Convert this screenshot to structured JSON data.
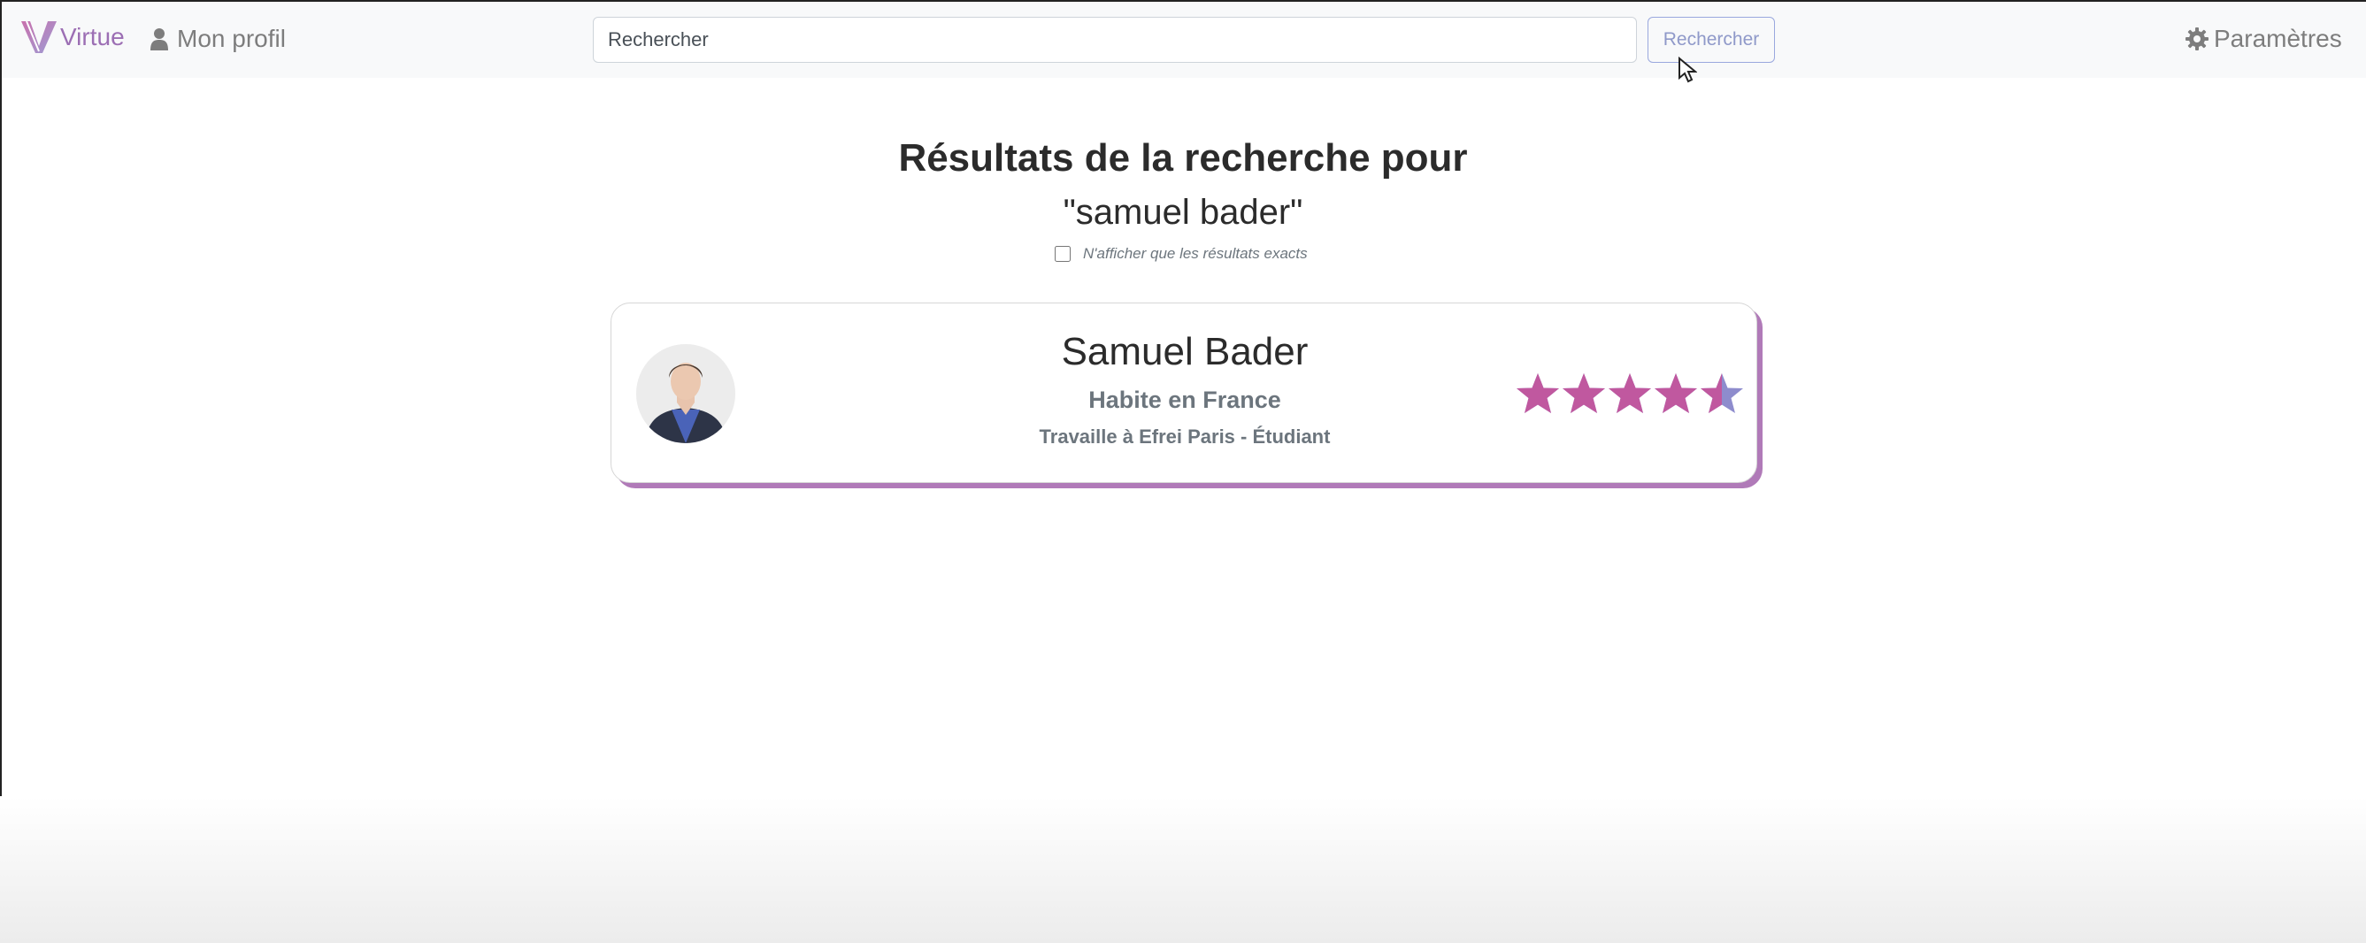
{
  "navbar": {
    "brand": "Virtue",
    "brand_icon": "virtue-logo-icon",
    "profile_label": "Mon profil",
    "profile_icon": "user-icon",
    "search_placeholder": "Rechercher",
    "search_button": "Rechercher",
    "settings_label": "Paramètres",
    "settings_icon": "gear-icon"
  },
  "results": {
    "title": "Résultats de la recherche pour",
    "query": "\"samuel bader\"",
    "exact_label": "N'afficher que les résultats exacts",
    "exact_checked": false
  },
  "cards": [
    {
      "name": "Samuel Bader",
      "home": "Habite en France",
      "work": "Travaille à Efrei Paris - Étudiant",
      "rating": 4.5,
      "rating_max": 5
    }
  ],
  "colors": {
    "accent": "#c0589f",
    "accent_secondary": "#8e8ccd",
    "brand": "#9c6fb4",
    "card_shadow": "#b07ab8"
  }
}
